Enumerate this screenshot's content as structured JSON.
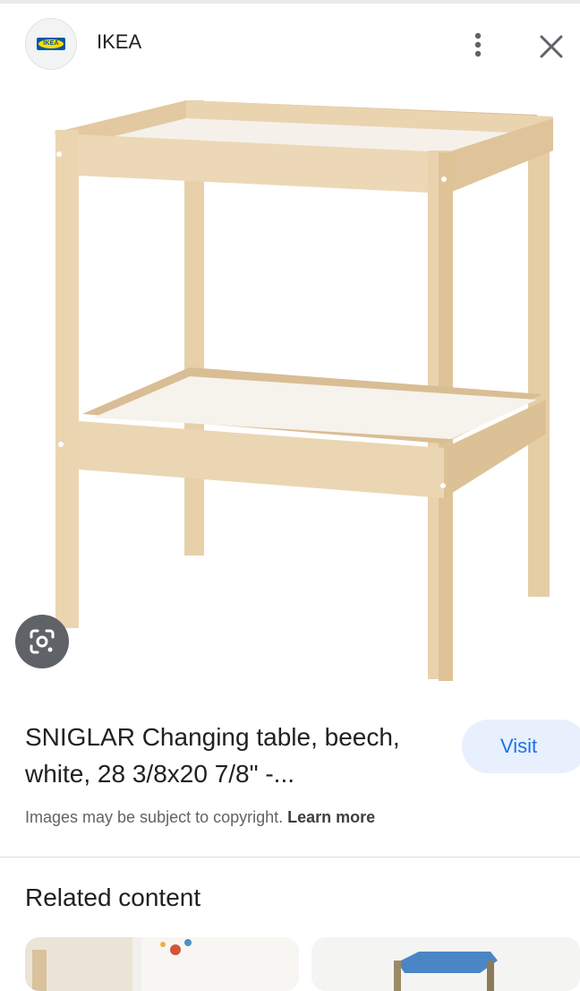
{
  "header": {
    "site_name": "IKEA",
    "logo_text": "IKEA",
    "more_icon": "more-vert-icon",
    "close_icon": "close-icon"
  },
  "image": {
    "alt": "SNIGLAR Changing table, beech, white",
    "lens_icon": "lens-search-icon"
  },
  "product": {
    "title": "SNIGLAR Changing table, beech, white, 28 3/8x20 7/8\" -...",
    "visit_label": "Visit"
  },
  "copyright": {
    "text": "Images may be subject to copyright.",
    "link_label": "Learn more"
  },
  "related": {
    "title": "Related content"
  },
  "colors": {
    "accent": "#1a73e8",
    "visit_bg": "#e8f0fe",
    "wood": "#e9d3ae",
    "ikea_blue": "#0058a3",
    "ikea_yellow": "#ffdb00"
  }
}
